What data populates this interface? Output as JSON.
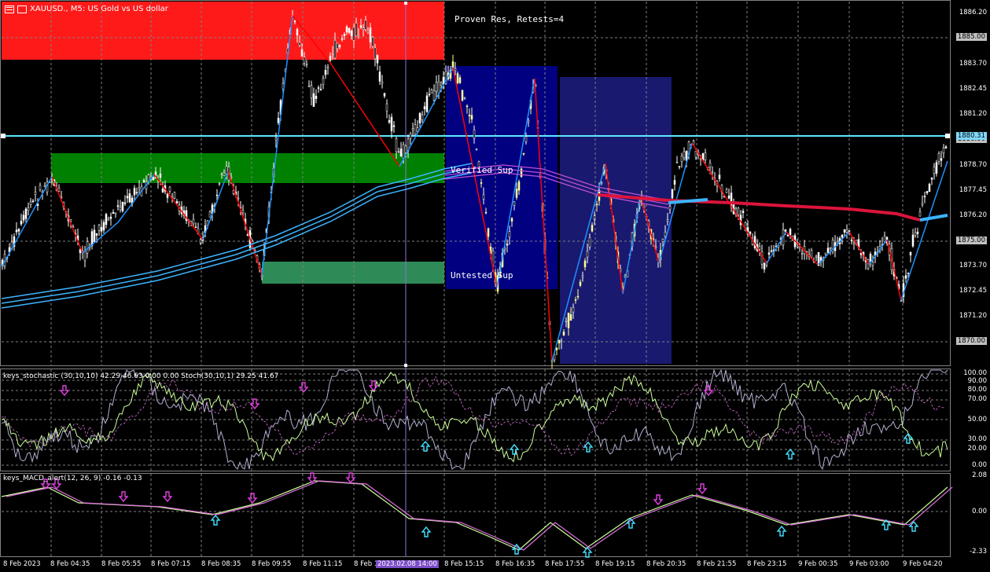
{
  "window": {
    "symbol_title": "XAUUSD., M5: US Gold vs US dollar"
  },
  "zones": {
    "proven_res": "Proven Res, Retests=4",
    "verified_sup": "Verified Sup",
    "untested_sup": "Untested Sup"
  },
  "indicators": {
    "stoch_title": "keys_stochastic (30,10,10) 42.29 46.63 0.00 0.00 Stoch(30,10,1) 29.25 41.67",
    "macd_title": "keys_MACD_alert(12, 26, 9) -0.16 -0.13"
  },
  "price_axis": [
    "1886.20",
    "1885.00",
    "1883.70",
    "1882.45",
    "1881.20",
    "1880.00",
    "1878.70",
    "1877.45",
    "1876.20",
    "1875.00",
    "1873.70",
    "1872.45",
    "1871.20",
    "1870.00"
  ],
  "price_highlight_top": "1880.31",
  "stoch_axis": [
    "100.00",
    "90.00",
    "80.00",
    "70.00",
    "50.00",
    "30.00",
    "20.00",
    "0.00"
  ],
  "macd_axis": [
    "2.08",
    "0.00",
    "-2.33"
  ],
  "time_axis": [
    "8 Feb 2023",
    "8 Feb 04:35",
    "8 Feb 05:55",
    "8 Feb 07:15",
    "8 Feb 08:35",
    "8 Feb 09:55",
    "8 Feb 11:15",
    "8 Feb 12:35",
    "8 Feb 15:15",
    "8 Feb 16:35",
    "8 Feb 17:55",
    "8 Feb 19:15",
    "8 Feb 20:35",
    "8 Feb 21:55",
    "8 Feb 23:15",
    "9 Feb 00:35",
    "9 Feb 03:00",
    "9 Feb 04:20"
  ],
  "cursor_time": "2023.02.08 14:00",
  "colors": {
    "resistance": "#ff1a1a",
    "verified_support": "#008000",
    "untested_support": "#2e8b57",
    "blue_zone": "#000080",
    "blue_zone2": "#191970",
    "crosshair": "#9370db",
    "ma_blue": "#3cb4ff",
    "ma_red": "#dc143c",
    "zigzag_red": "#ff0000",
    "zigzag_blue": "#1e90ff"
  }
}
